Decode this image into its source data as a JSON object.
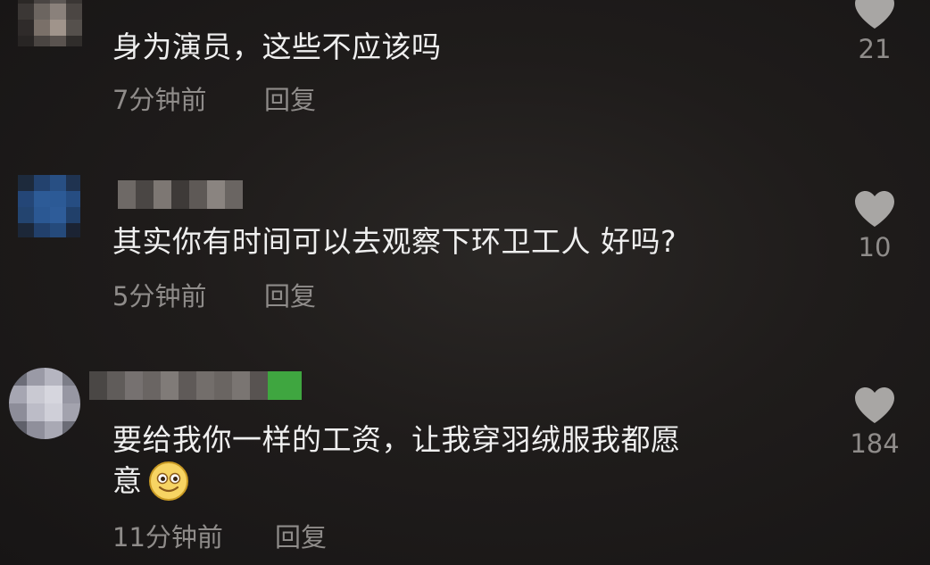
{
  "comments": [
    {
      "text": "身为演员，这些不应该吗",
      "time": "7分钟前",
      "reply_label": "回复",
      "like_count": "21"
    },
    {
      "text": "其实你有时间可以去观察下环卫工人 好吗?",
      "time": "5分钟前",
      "reply_label": "回复",
      "like_count": "10"
    },
    {
      "text_line1": "要给我你一样的工资，让我穿羽绒服我都愿",
      "text_line2": "意",
      "time": "11分钟前",
      "reply_label": "回复",
      "like_count": "184",
      "emoji": "smiling-face-icon"
    }
  ],
  "colors": {
    "background": "#1f1c1b",
    "text": "#efefef",
    "meta": "#8f8c8a",
    "heart": "#a8a6a4"
  }
}
